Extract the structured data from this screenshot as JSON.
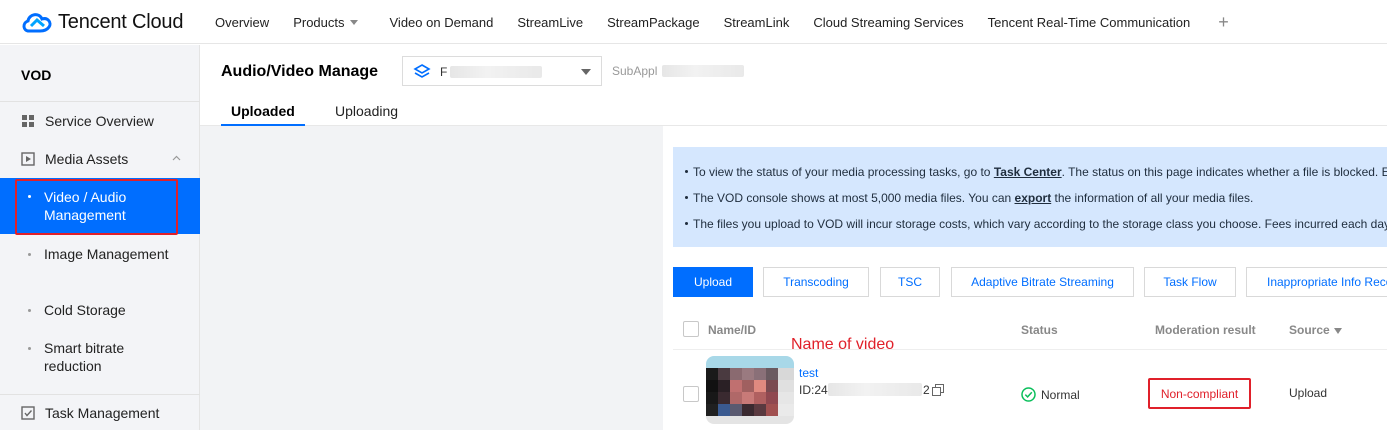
{
  "brand": {
    "logo_text": "Tencent Cloud"
  },
  "topnav": {
    "items": [
      "Overview",
      "Products",
      "Video on Demand",
      "StreamLive",
      "StreamPackage",
      "StreamLink",
      "Cloud Streaming Services",
      "Tencent Real-Time Communication"
    ],
    "plus": "+"
  },
  "sidebar": {
    "title": "VOD",
    "service_overview": "Service Overview",
    "media_assets": "Media Assets",
    "sub_items": [
      "Video / Audio Management",
      "Image Management",
      "Cold Storage",
      "Smart bitrate reduction"
    ],
    "task_management": "Task Management"
  },
  "header": {
    "title": "Audio/Video Manage",
    "app_select_value": "F",
    "subapp_label": "SubAppl"
  },
  "tabs": [
    "Uploaded",
    "Uploading"
  ],
  "notice": {
    "line1_pre": "To view the status of your media processing tasks, go to ",
    "line1_link": "Task Center",
    "line1_post": ". The status on this page indicates whether a file is blocked. E",
    "line2_pre": "The VOD console shows at most 5,000 media files. You can ",
    "line2_link": "export",
    "line2_post": " the information of all your media files.",
    "line3": "The files you upload to VOD will incur storage costs, which vary according to the storage class you choose. Fees incurred each day"
  },
  "toolbar": {
    "upload": "Upload",
    "transcoding": "Transcoding",
    "tsc": "TSC",
    "abs": "Adaptive Bitrate Streaming",
    "task_flow": "Task Flow",
    "inappropriate": "Inappropriate Info Reco"
  },
  "table": {
    "headers": {
      "name": "Name/ID",
      "status": "Status",
      "moderation": "Moderation result",
      "source": "Source"
    },
    "rows": [
      {
        "name": "test",
        "id_prefix": "ID:24",
        "id_suffix": "2",
        "status": "Normal",
        "moderation": "Non-compliant",
        "source": "Upload"
      }
    ]
  },
  "annotation": "Name of video",
  "colors": {
    "accent": "#006eff",
    "highlight_red": "#e0202a",
    "success_green": "#0abf5b"
  }
}
